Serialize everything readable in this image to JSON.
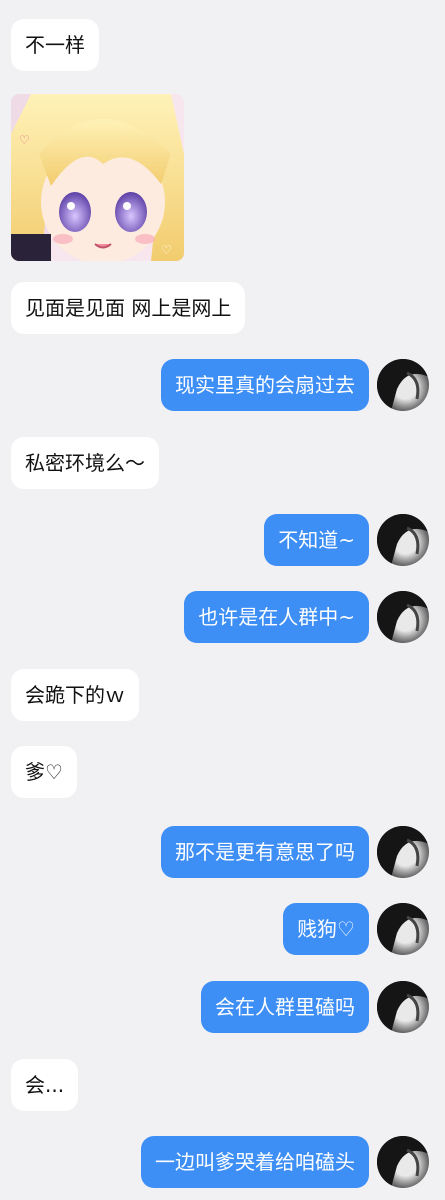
{
  "messages": [
    {
      "side": "in",
      "text": "不一样"
    },
    {
      "side": "in",
      "kind": "sticker",
      "sticker": "anime-girl-sticker"
    },
    {
      "side": "in",
      "text": "见面是见面 网上是网上"
    },
    {
      "side": "out",
      "text": "现实里真的会扇过去"
    },
    {
      "side": "in",
      "text": "私密环境么～"
    },
    {
      "side": "out",
      "text": "不知道~"
    },
    {
      "side": "out",
      "text": "也许是在人群中~"
    },
    {
      "side": "in",
      "text": "会跪下的ｗ"
    },
    {
      "side": "in",
      "text": "爹♡"
    },
    {
      "side": "out",
      "text": "那不是更有意思了吗"
    },
    {
      "side": "out",
      "text": "贱狗♡"
    },
    {
      "side": "out",
      "text": "会在人群里磕吗"
    },
    {
      "side": "in",
      "text": "会..."
    },
    {
      "side": "out",
      "text": "一边叫爹哭着给咱磕头"
    }
  ],
  "colors": {
    "background": "#f1f1f4",
    "incoming_bubble": "#ffffff",
    "outgoing_bubble": "#3d8ef5",
    "outgoing_text": "#ffffff",
    "incoming_text": "#111111"
  }
}
